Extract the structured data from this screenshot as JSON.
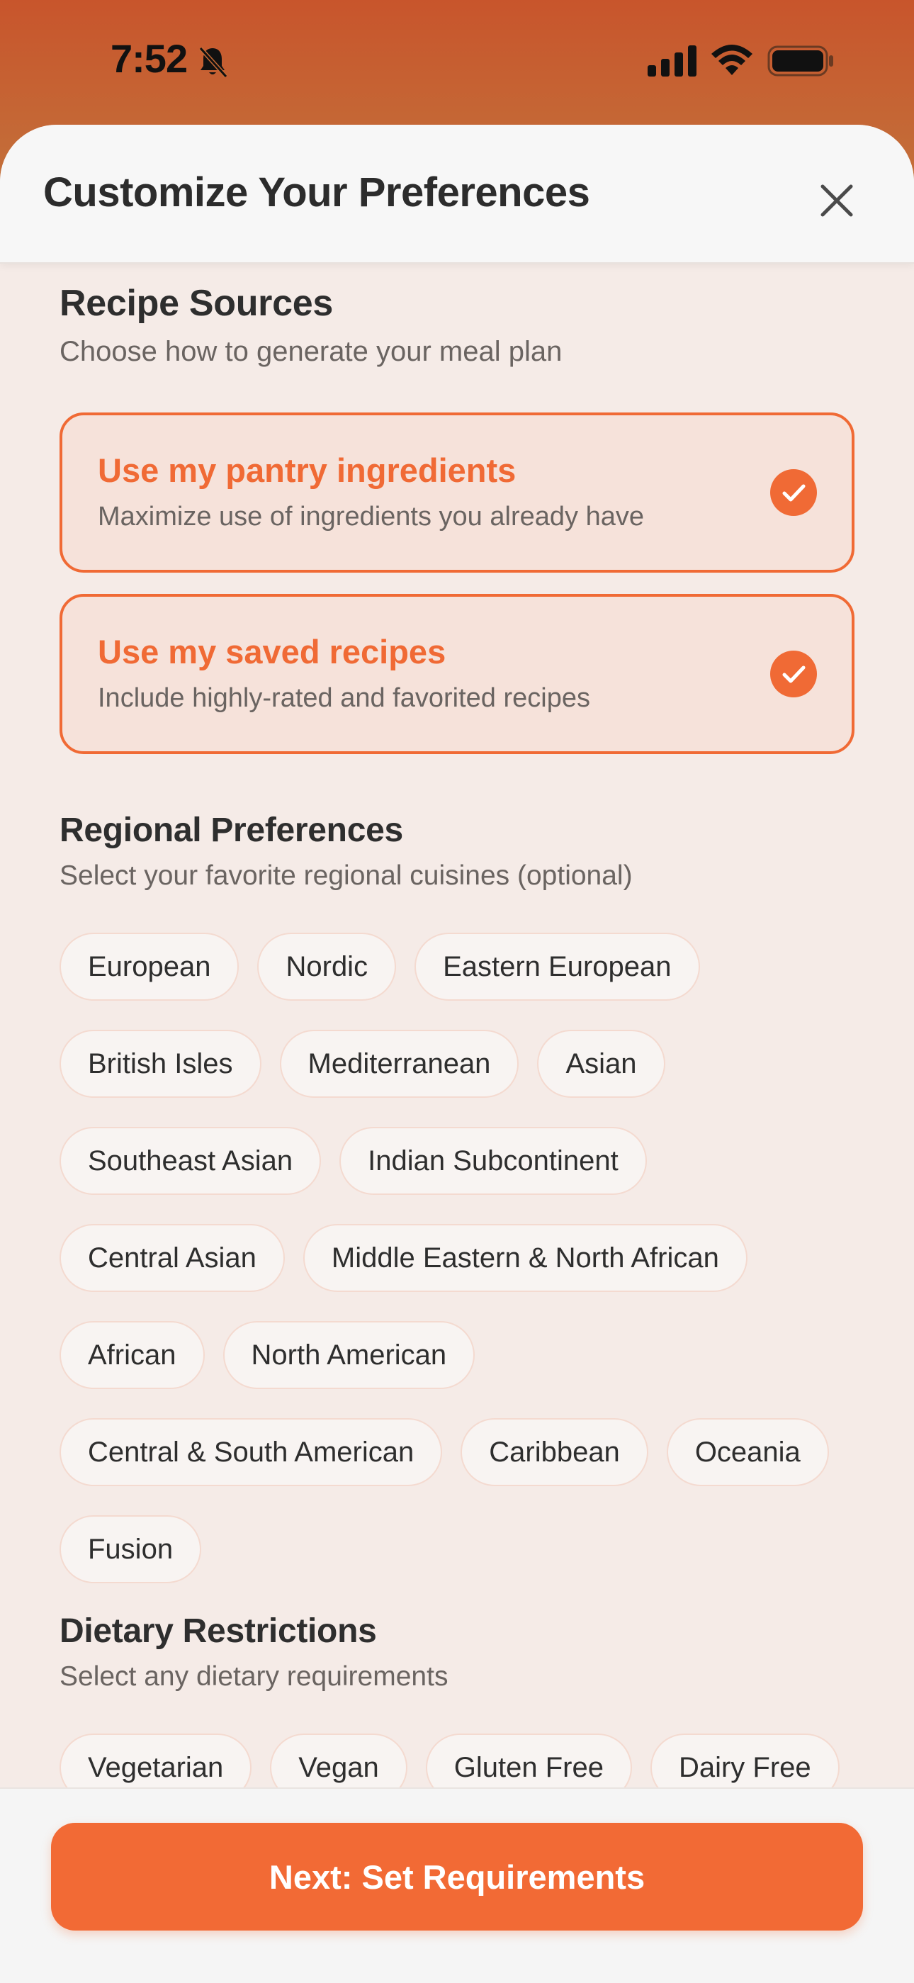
{
  "status_bar": {
    "time": "7:52"
  },
  "header": {
    "title": "Customize Your Preferences"
  },
  "recipe_sources": {
    "title": "Recipe Sources",
    "subtitle": "Choose how to generate your meal plan",
    "options": [
      {
        "title": "Use my pantry ingredients",
        "description": "Maximize use of ingredients you already have",
        "selected": true
      },
      {
        "title": "Use my saved recipes",
        "description": "Include highly-rated and favorited recipes",
        "selected": true
      }
    ]
  },
  "regional": {
    "title": "Regional Preferences",
    "subtitle": "Select your favorite regional cuisines (optional)",
    "chips": [
      "European",
      "Nordic",
      "Eastern European",
      "British Isles",
      "Mediterranean",
      "Asian",
      "Southeast Asian",
      "Indian Subcontinent",
      "Central Asian",
      "Middle Eastern & North African",
      "African",
      "North American",
      "Central & South American",
      "Caribbean",
      "Oceania",
      "Fusion"
    ]
  },
  "dietary": {
    "title": "Dietary Restrictions",
    "subtitle": "Select any dietary requirements",
    "chips": [
      "Vegetarian",
      "Vegan",
      "Gluten Free",
      "Dairy Free"
    ]
  },
  "footer": {
    "next_label": "Next: Set Requirements"
  },
  "colors": {
    "accent": "#F26A35",
    "sheet_background": "#F5EBE7",
    "chip_border": "#F4DAD0"
  }
}
